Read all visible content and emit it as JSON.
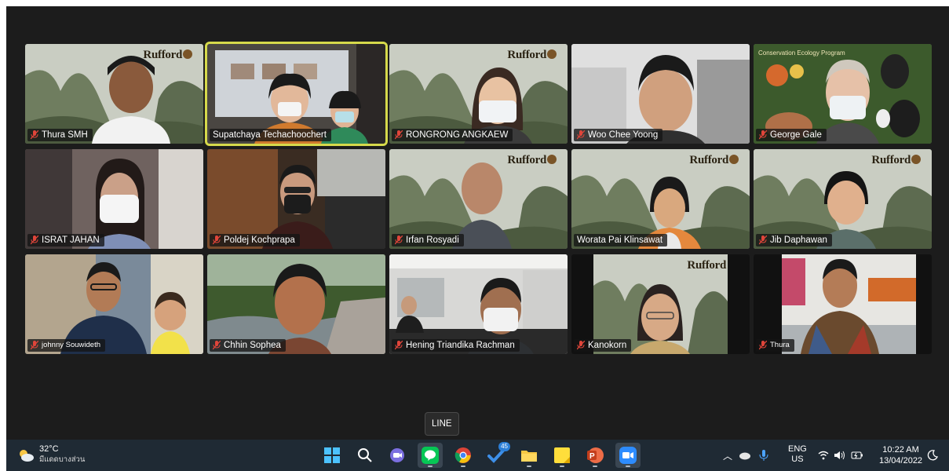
{
  "meeting": {
    "logo_text": "Rufford",
    "participants": [
      {
        "name": "Thura SMH",
        "muted": true
      },
      {
        "name": "Supatchaya Techachoochert",
        "muted": false,
        "active": true
      },
      {
        "name": "RONGRONG ANGKAEW",
        "muted": true
      },
      {
        "name": "Woo Chee Yoong",
        "muted": true
      },
      {
        "name": "George Gale",
        "muted": true
      },
      {
        "name": "ISRAT JAHAN",
        "muted": true
      },
      {
        "name": "Poldej Kochprapa",
        "muted": true
      },
      {
        "name": "Irfan Rosyadi",
        "muted": true
      },
      {
        "name": "Worata Pai Klinsawat",
        "muted": false
      },
      {
        "name": "Jib Daphawan",
        "muted": true
      },
      {
        "name": "johnny Souwideth",
        "muted": true
      },
      {
        "name": "Chhin Sophea",
        "muted": true
      },
      {
        "name": "Hening Triandika Rachman",
        "muted": true
      },
      {
        "name": "Kanokorn",
        "muted": true
      },
      {
        "name": "Thura",
        "muted": true
      }
    ],
    "background_caption": "Conservation Ecology Program"
  },
  "tooltip": "LINE",
  "taskbar": {
    "weather_temp": "32°C",
    "weather_desc": "มีแดดบางส่วน",
    "apps": [
      "windows-start",
      "search",
      "teams-chat",
      "line",
      "chrome",
      "todo",
      "file-explorer",
      "sticky-notes",
      "powerpoint",
      "zoom"
    ],
    "todo_badge": "45",
    "lang_line1": "ENG",
    "lang_line2": "US",
    "time": "10:22 AM",
    "date": "13/04/2022"
  },
  "colors": {
    "screen_bg": "#1c1c1c",
    "taskbar_bg": "#1f2a34",
    "active_border": "#d6d94b",
    "muted_icon": "#e0453a"
  }
}
